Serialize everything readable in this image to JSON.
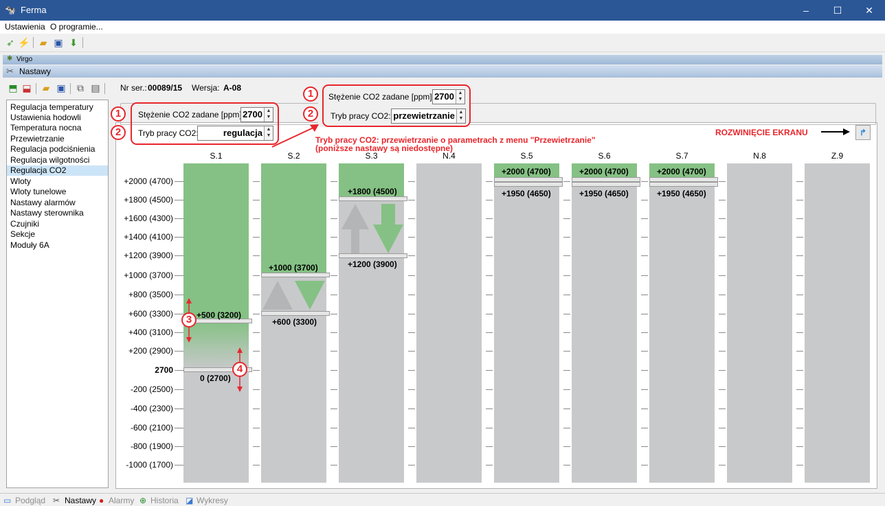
{
  "window": {
    "title": "Ferma",
    "minimize": "–",
    "maximize": "☐",
    "close": "✕"
  },
  "menu": {
    "settings": "Ustawienia",
    "about": "O programie..."
  },
  "panels": {
    "virgo": "Virgo",
    "nastawy": "Nastawy"
  },
  "device": {
    "serial_label": "Nr ser.:",
    "serial": "00089/15",
    "version_label": "Wersja:",
    "version": "A-08"
  },
  "sidebar": {
    "items": [
      "Regulacja temperatury",
      "Ustawienia hodowli",
      "Temperatura nocna",
      "Przewietrzanie",
      "Regulacja podciśnienia",
      "Regulacja wilgotności",
      "Regulacja CO2",
      "Wloty",
      "Wloty tunelowe",
      "Nastawy alarmów",
      "Nastawy sterownika",
      "Czujniki",
      "Sekcje",
      "Moduły 6A"
    ],
    "selected_index": 6
  },
  "form": {
    "co2_label": "Stężenie CO2 zadane [ppm]:",
    "co2_value": "2700",
    "mode_label": "Tryb pracy CO2:",
    "mode_value": "regulacja"
  },
  "callout": {
    "co2_label": "Stężenie CO2 zadane [ppm]:",
    "co2_value": "2700",
    "mode_label": "Tryb pracy CO2:",
    "mode_value": "przewietrzanie",
    "note_line1": "Tryb pracy CO2: przewietrzanie o parametrach z menu \"Przewietrzanie\"",
    "note_line2": "(poniższe nastawy są niedostępne)"
  },
  "annotation": {
    "expand": "ROZWINIĘCIE EKRANU",
    "n1": "1",
    "n2": "2",
    "n3": "3",
    "n4": "4"
  },
  "chart": {
    "columns": [
      "S.1",
      "S.2",
      "S.3",
      "N.4",
      "S.5",
      "S.6",
      "S.7",
      "N.8",
      "Z.9"
    ],
    "y_labels": [
      "+2000 (4700)",
      "+1800 (4500)",
      "+1600 (4300)",
      "+1400 (4100)",
      "+1200 (3900)",
      "+1000 (3700)",
      "+800 (3500)",
      "+600 (3300)",
      "+400 (3100)",
      "+200 (2900)",
      "2700",
      "-200 (2500)",
      "-400 (2300)",
      "-600 (2100)",
      "-800 (1900)",
      "-1000 (1700)"
    ],
    "s1_upper": "+500 (3200)",
    "s1_lower": "0 (2700)",
    "s2_upper": "+1000 (3700)",
    "s2_lower": "+600 (3300)",
    "s3_upper": "+1800 (4500)",
    "s3_lower": "+1200 (3900)",
    "s567_upper": "+2000 (4700)",
    "s567_lower": "+1950 (4650)"
  },
  "colors": {
    "green": "#85c184",
    "gray": "#c8c9cb",
    "red": "#e8262c"
  },
  "statusbar": {
    "podglad": "Podgląd",
    "nastawy": "Nastawy",
    "alarmy": "Alarmy",
    "historia": "Historia",
    "wykresy": "Wykresy"
  }
}
